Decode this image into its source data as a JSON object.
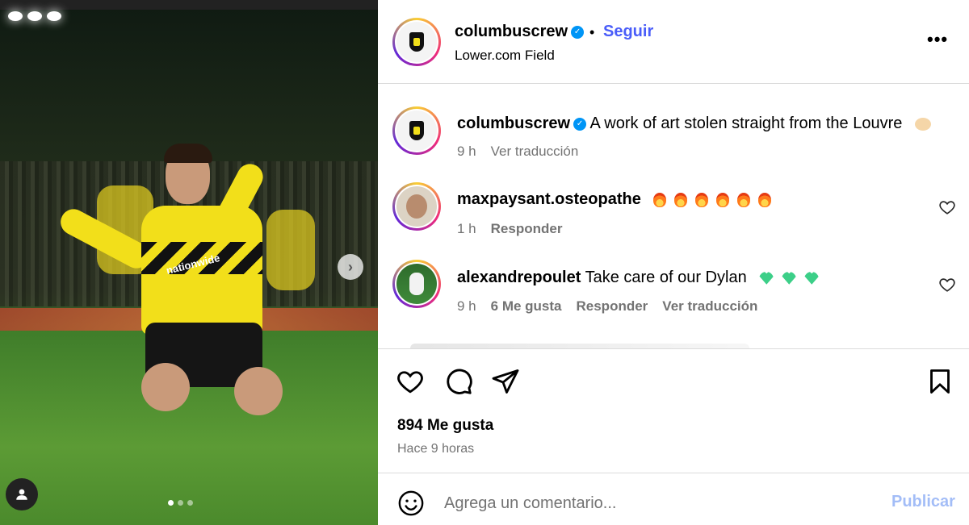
{
  "post": {
    "account": "columbuscrew",
    "follow_label": "Seguir",
    "separator": "•",
    "location": "Lower.com Field",
    "more_label": "•••",
    "likes": "894 Me gusta",
    "time_ago": "Hace 9 horas",
    "photo_sponsor": "nationwide",
    "carousel_total": 3,
    "carousel_active": 1
  },
  "caption": {
    "user": "columbuscrew",
    "text": "A work of art stolen straight from the Louvre",
    "time": "9 h",
    "translate": "Ver traducción"
  },
  "comments": [
    {
      "user": "maxpaysant.osteopathe",
      "text": "",
      "emoji": "fire x6",
      "time": "1 h",
      "reply": "Responder"
    },
    {
      "user": "alexandrepoulet",
      "text": "Take care of our Dylan",
      "emoji": "green-heart x3",
      "time": "9 h",
      "likes": "6 Me gusta",
      "reply": "Responder",
      "translate": "Ver traducción"
    }
  ],
  "composer": {
    "placeholder": "Agrega un comentario...",
    "publish_label": "Publicar"
  },
  "colors": {
    "link_blue": "#4a5df9",
    "verified_blue": "#0095f6",
    "muted": "#737373",
    "publish_disabled": "#a3bdf7",
    "crew_yellow": "#f2df1a"
  }
}
